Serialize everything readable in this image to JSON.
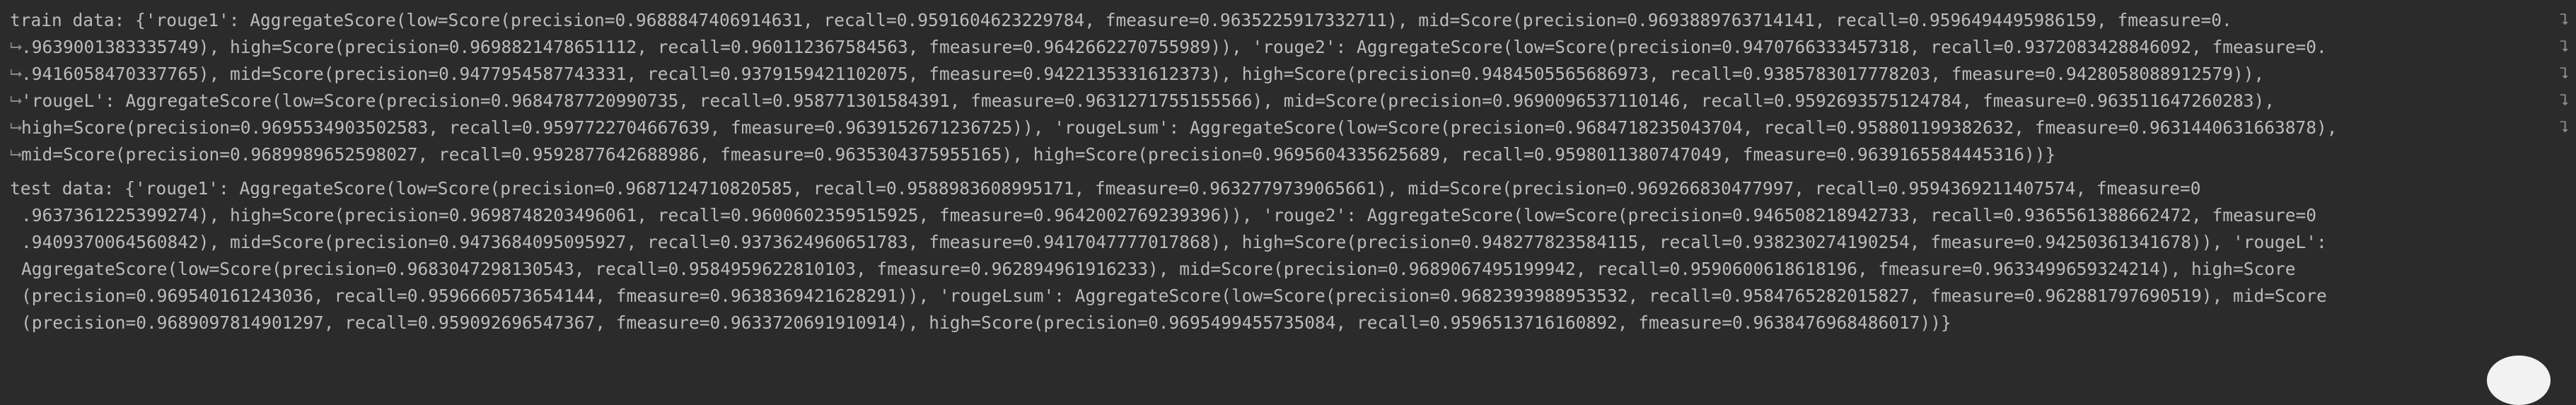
{
  "console": {
    "wrap_icon": "soft-wrap-arrow",
    "lines": [
      "train data: {'rouge1': AggregateScore(low=Score(precision=0.9688847406914631, recall=0.9591604623229784, fmeasure=0.9635225917332711), mid=Score(precision=0.9693889763714141, recall=0.9596494495986159, fmeasure=0.",
      ".9639001383335749), high=Score(precision=0.9698821478651112, recall=0.960112367584563, fmeasure=0.9642662270755989)), 'rouge2': AggregateScore(low=Score(precision=0.9470766333457318, recall=0.9372083428846092, fmeasure=0.",
      ".9416058470337765), mid=Score(precision=0.9477954587743331, recall=0.9379159421102075, fmeasure=0.9422135331612373), high=Score(precision=0.9484505565686973, recall=0.9385783017778203, fmeasure=0.9428058088912579)),",
      "'rougeL': AggregateScore(low=Score(precision=0.9684787720990735, recall=0.958771301584391, fmeasure=0.9631271755155566), mid=Score(precision=0.9690096537110146, recall=0.9592693575124784, fmeasure=0.963511647260283),",
      "high=Score(precision=0.9695534903502583, recall=0.9597722704667639, fmeasure=0.9639152671236725)), 'rougeLsum': AggregateScore(low=Score(precision=0.9684718235043704, recall=0.958801199382632, fmeasure=0.9631440631663878),",
      "mid=Score(precision=0.9689989652598027, recall=0.9592877642688986, fmeasure=0.9635304375955165), high=Score(precision=0.9695604335625689, recall=0.9598011380747049, fmeasure=0.9639165584445316))}",
      "test data: {'rouge1': AggregateScore(low=Score(precision=0.9687124710820585, recall=0.9588983608995171, fmeasure=0.9632779739065661), mid=Score(precision=0.969266830477997, recall=0.9594369211407574, fmeasure=0",
      ".9637361225399274), high=Score(precision=0.9698748203496061, recall=0.9600602359515925, fmeasure=0.9642002769239396)), 'rouge2': AggregateScore(low=Score(precision=0.946508218942733, recall=0.9365561388662472, fmeasure=0",
      ".9409370064560842), mid=Score(precision=0.9473684095095927, recall=0.9373624960651783, fmeasure=0.9417047777017868), high=Score(precision=0.948277823584115, recall=0.938230274190254, fmeasure=0.94250361341678)), 'rougeL':",
      "AggregateScore(low=Score(precision=0.9683047298130543, recall=0.9584959622810103, fmeasure=0.962894961916233), mid=Score(precision=0.9689067495199942, recall=0.9590600618618196, fmeasure=0.9633499659324214), high=Score",
      "(precision=0.969540161243036, recall=0.9596660573654144, fmeasure=0.9638369421628291)), 'rougeLsum': AggregateScore(low=Score(precision=0.9682393988953532, recall=0.9584765282015827, fmeasure=0.962881797690519), mid=Score",
      "(precision=0.9689097814901297, recall=0.959092696547367, fmeasure=0.9633720691910914), high=Score(precision=0.9695499455735084, recall=0.9596513716160892, fmeasure=0.9638476968486017))}"
    ]
  }
}
